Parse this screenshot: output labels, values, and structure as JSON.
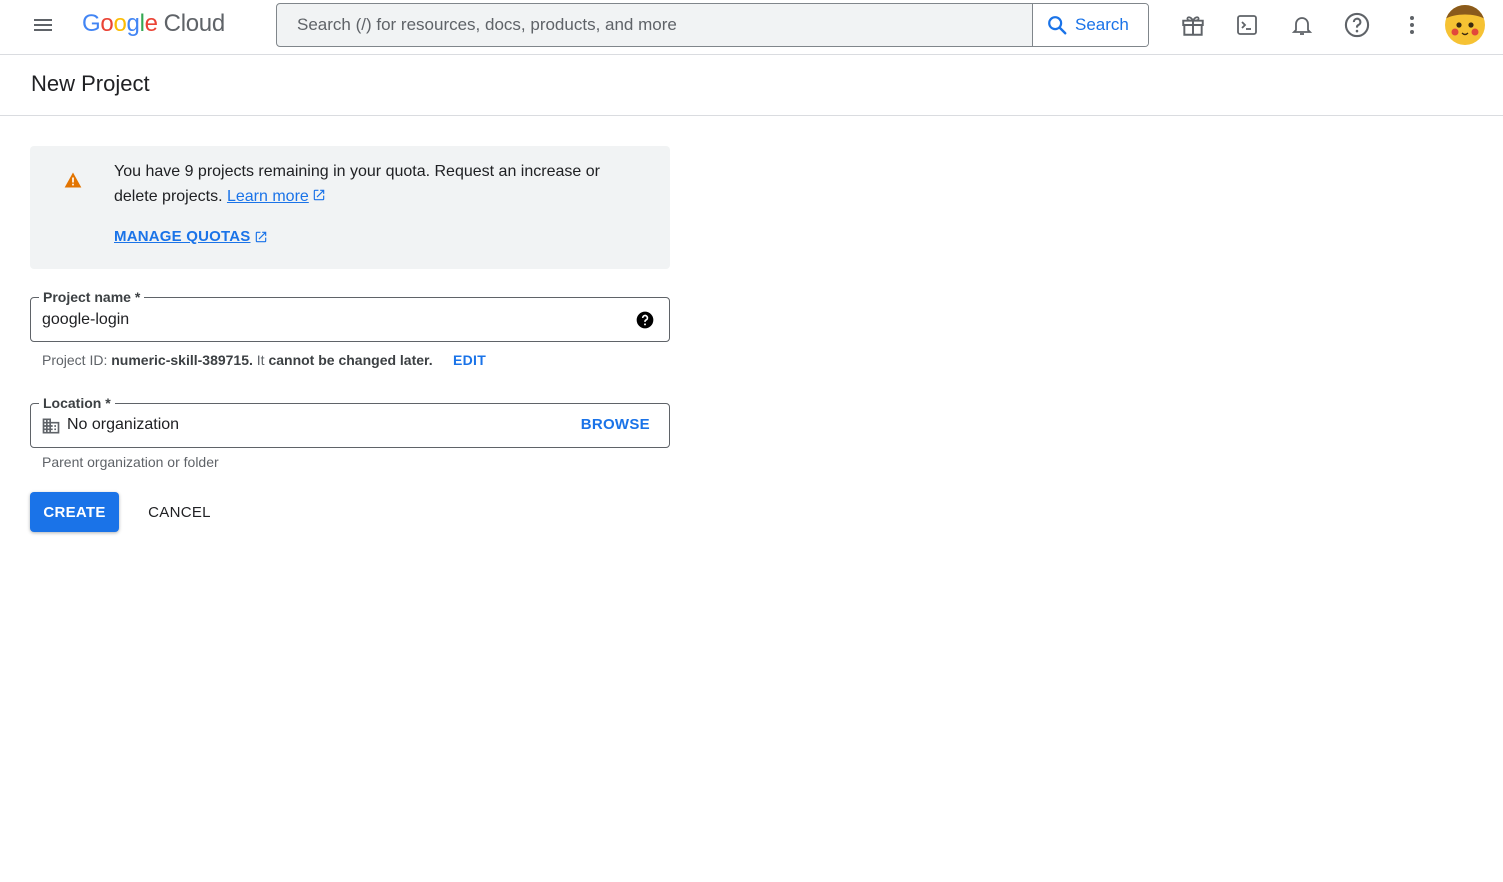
{
  "topbar": {
    "menu_icon": "hamburger-menu-icon",
    "logo": {
      "g1": "G",
      "o1": "o",
      "o2": "o",
      "g2": "g",
      "l": "l",
      "e": "e",
      "product": "Cloud"
    },
    "search": {
      "placeholder": "Search (/) for resources, docs, products, and more",
      "value": "",
      "button_label": "Search"
    },
    "icons": [
      "gift-icon",
      "cloud-shell-terminal-icon",
      "notifications-bell-icon",
      "help-question-icon",
      "more-vert-icon"
    ],
    "avatar": "user-avatar"
  },
  "page": {
    "title": "New Project"
  },
  "notice": {
    "text": "You have 9 projects remaining in your quota. Request an increase or delete projects.",
    "learn_more": "Learn more",
    "manage_quotas": "MANAGE QUOTAS",
    "icon": "warning-triangle-icon"
  },
  "form": {
    "project_name": {
      "label": "Project name *",
      "value": "google-login"
    },
    "project_id": {
      "prefix": "Project ID:",
      "id": "numeric-skill-389715.",
      "suffix": "It",
      "bold_suffix": "cannot be changed later.",
      "edit": "EDIT"
    },
    "location": {
      "label": "Location *",
      "value": "No organization",
      "browse": "BROWSE",
      "hint": "Parent organization or folder"
    }
  },
  "actions": {
    "create": "CREATE",
    "cancel": "CANCEL"
  },
  "colors": {
    "primary": "#1a73e8",
    "warning": "#e37400",
    "border": "#dadce0",
    "notice_bg": "#f1f3f4"
  }
}
